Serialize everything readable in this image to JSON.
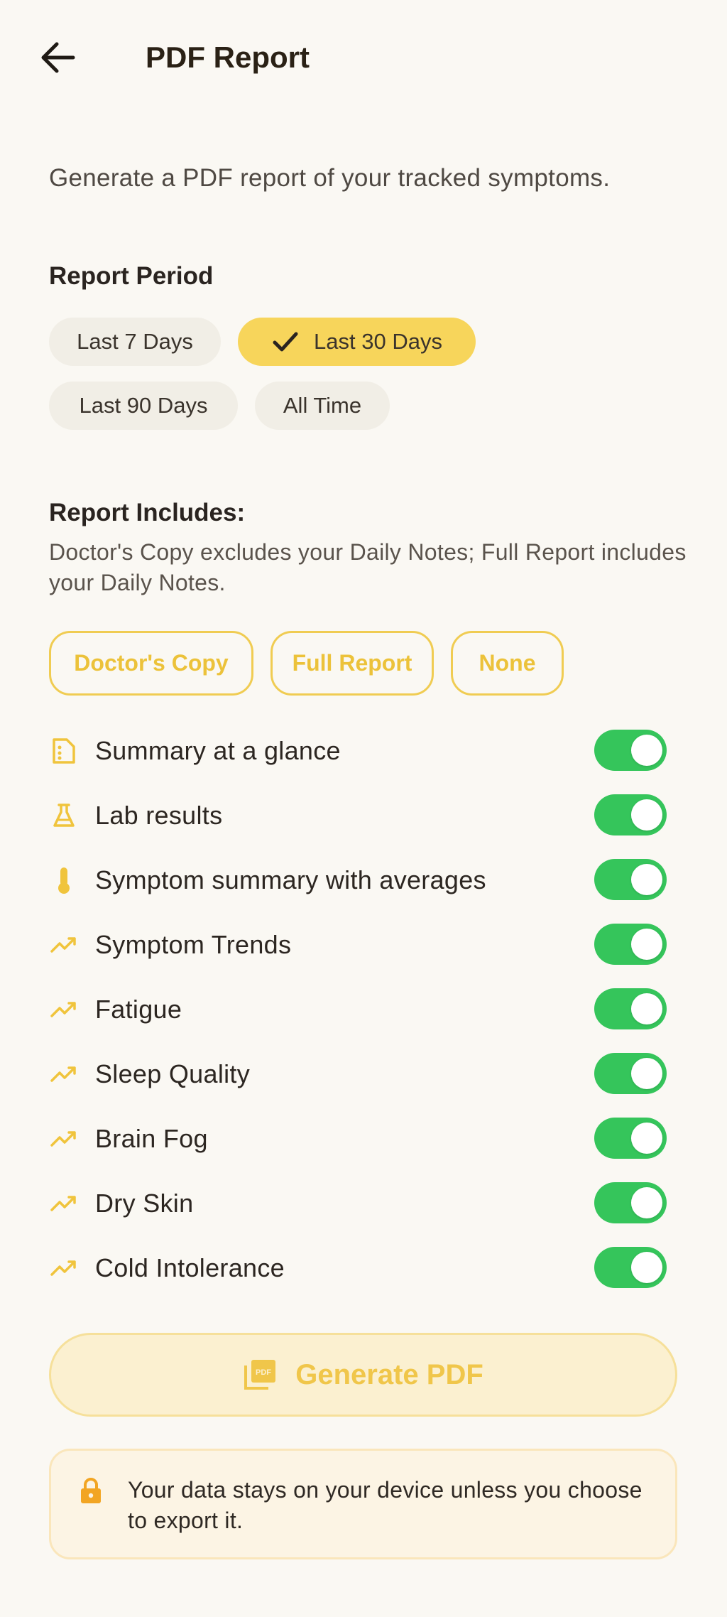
{
  "header": {
    "title": "PDF Report",
    "back_icon": "arrow-left-icon"
  },
  "intro_text": "Generate a PDF report of your tracked symptoms.",
  "report_period": {
    "title": "Report Period",
    "options": [
      {
        "label": "Last 7 Days",
        "selected": false
      },
      {
        "label": "Last 30 Days",
        "selected": true
      },
      {
        "label": "Last 90 Days",
        "selected": false
      },
      {
        "label": "All Time",
        "selected": false
      }
    ]
  },
  "report_includes": {
    "title": "Report Includes:",
    "description": "Doctor's Copy excludes your Daily Notes; Full Report includes your Daily Notes.",
    "presets": [
      "Doctor's Copy",
      "Full Report",
      "None"
    ],
    "items": [
      {
        "label": "Summary at a glance",
        "icon": "summary-icon",
        "enabled": true
      },
      {
        "label": "Lab results",
        "icon": "flask-icon",
        "enabled": true
      },
      {
        "label": "Symptom summary with averages",
        "icon": "thermometer-icon",
        "enabled": true
      },
      {
        "label": "Symptom Trends",
        "icon": "trend-icon",
        "enabled": true
      },
      {
        "label": "Fatigue",
        "icon": "trend-icon",
        "enabled": true
      },
      {
        "label": "Sleep Quality",
        "icon": "trend-icon",
        "enabled": true
      },
      {
        "label": "Brain Fog",
        "icon": "trend-icon",
        "enabled": true
      },
      {
        "label": "Dry Skin",
        "icon": "trend-icon",
        "enabled": true
      },
      {
        "label": "Cold Intolerance",
        "icon": "trend-icon",
        "enabled": true
      }
    ]
  },
  "generate_button": {
    "label": "Generate PDF",
    "icon": "pdf-icon"
  },
  "privacy_note": {
    "text": "Your data stays on your device unless you choose to export it.",
    "icon": "lock-icon"
  },
  "colors": {
    "background": "#faf8f3",
    "accent": "#f7d55b",
    "toggle_on": "#35c55b",
    "icon": "#f0c43c"
  }
}
